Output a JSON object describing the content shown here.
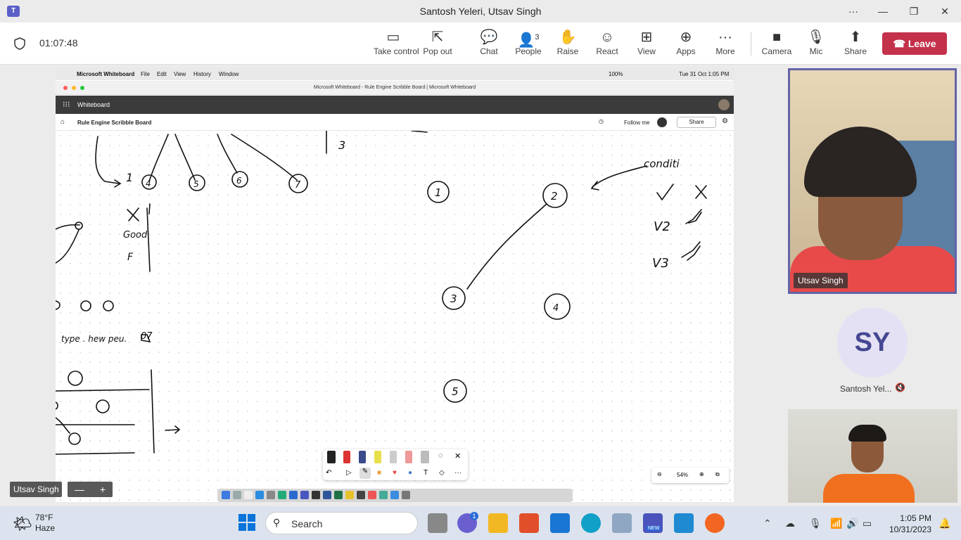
{
  "window": {
    "title": "Santosh Yeleri, Utsav Singh",
    "more": "···",
    "minimize": "—",
    "restore": "❐",
    "close": "✕"
  },
  "meeting": {
    "timer": "01:07:48"
  },
  "toolbar": {
    "take_control": "Take control",
    "pop_out": "Pop out",
    "chat": "Chat",
    "people": "People",
    "people_count": "3",
    "raise": "Raise",
    "react": "React",
    "view": "View",
    "apps": "Apps",
    "more": "More",
    "camera": "Camera",
    "mic": "Mic",
    "share": "Share",
    "leave": "Leave"
  },
  "shared_screen": {
    "mac_menu": {
      "app": "Microsoft Whiteboard",
      "items": [
        "File",
        "Edit",
        "View",
        "History",
        "Window"
      ],
      "status": "100%",
      "datetime": "Tue 31 Oct  1:05 PM"
    },
    "window_title": "Microsoft Whiteboard - Rule Engine Scribble Board | Microsoft Whiteboard",
    "app_header": "Whiteboard",
    "board_name": "Rule Engine Scribble Board",
    "follow_me": "Follow me",
    "share": "Share",
    "zoom": "54%",
    "ink_labels": {
      "n1": "1",
      "n2": "2",
      "n3": "3",
      "n4": "4",
      "n5": "5",
      "side3": "3",
      "top4": "4",
      "top5": "5",
      "top6": "6",
      "top7": "7",
      "one": "1",
      "cond": "conditi",
      "v2": "V2",
      "v3": "V3",
      "good": "Good",
      "f": "F",
      "type": "type . hew peu.",
      "o7": "07"
    }
  },
  "participants": [
    {
      "name": "Utsav Singh",
      "role": "video"
    },
    {
      "name": "Santosh Yel...",
      "initials": "SY",
      "muted": true
    },
    {
      "name": "Utsav Singh",
      "role": "self-view"
    }
  ],
  "taskbar": {
    "weather_temp": "78°F",
    "weather_desc": "Haze",
    "search": "Search",
    "time": "1:05 PM",
    "date": "10/31/2023",
    "chat_badge": "1",
    "teams_new": "NEW"
  },
  "colors": {
    "accent": "#6264a7",
    "leave": "#c4314b"
  }
}
